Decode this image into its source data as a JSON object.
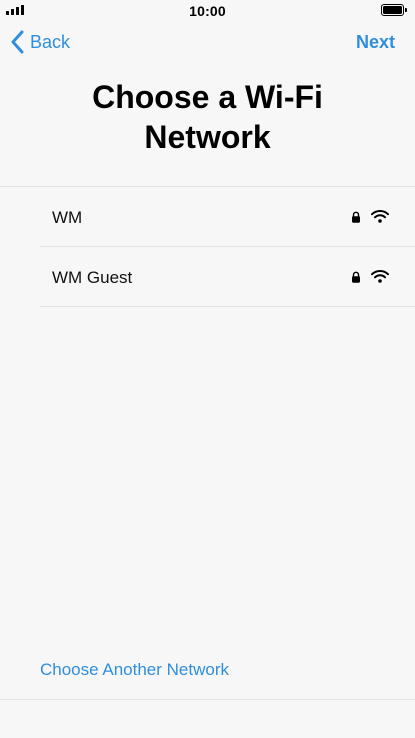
{
  "status_bar": {
    "time": "10:00",
    "signal_icon": "cellular-signal-icon",
    "battery_icon": "battery-icon",
    "battery_level": 1.0
  },
  "nav": {
    "back_label": "Back",
    "next_label": "Next"
  },
  "title": "Choose a Wi-Fi Network",
  "networks": [
    {
      "name": "WM",
      "secured": true,
      "icons": [
        "lock-icon",
        "wifi-icon"
      ]
    },
    {
      "name": "WM Guest",
      "secured": true,
      "icons": [
        "lock-icon",
        "wifi-icon"
      ]
    }
  ],
  "other_network_label": "Choose Another Network",
  "colors": {
    "accent": "#2f8ede",
    "background": "#f7f7f8",
    "divider": "#e2e2e4"
  }
}
